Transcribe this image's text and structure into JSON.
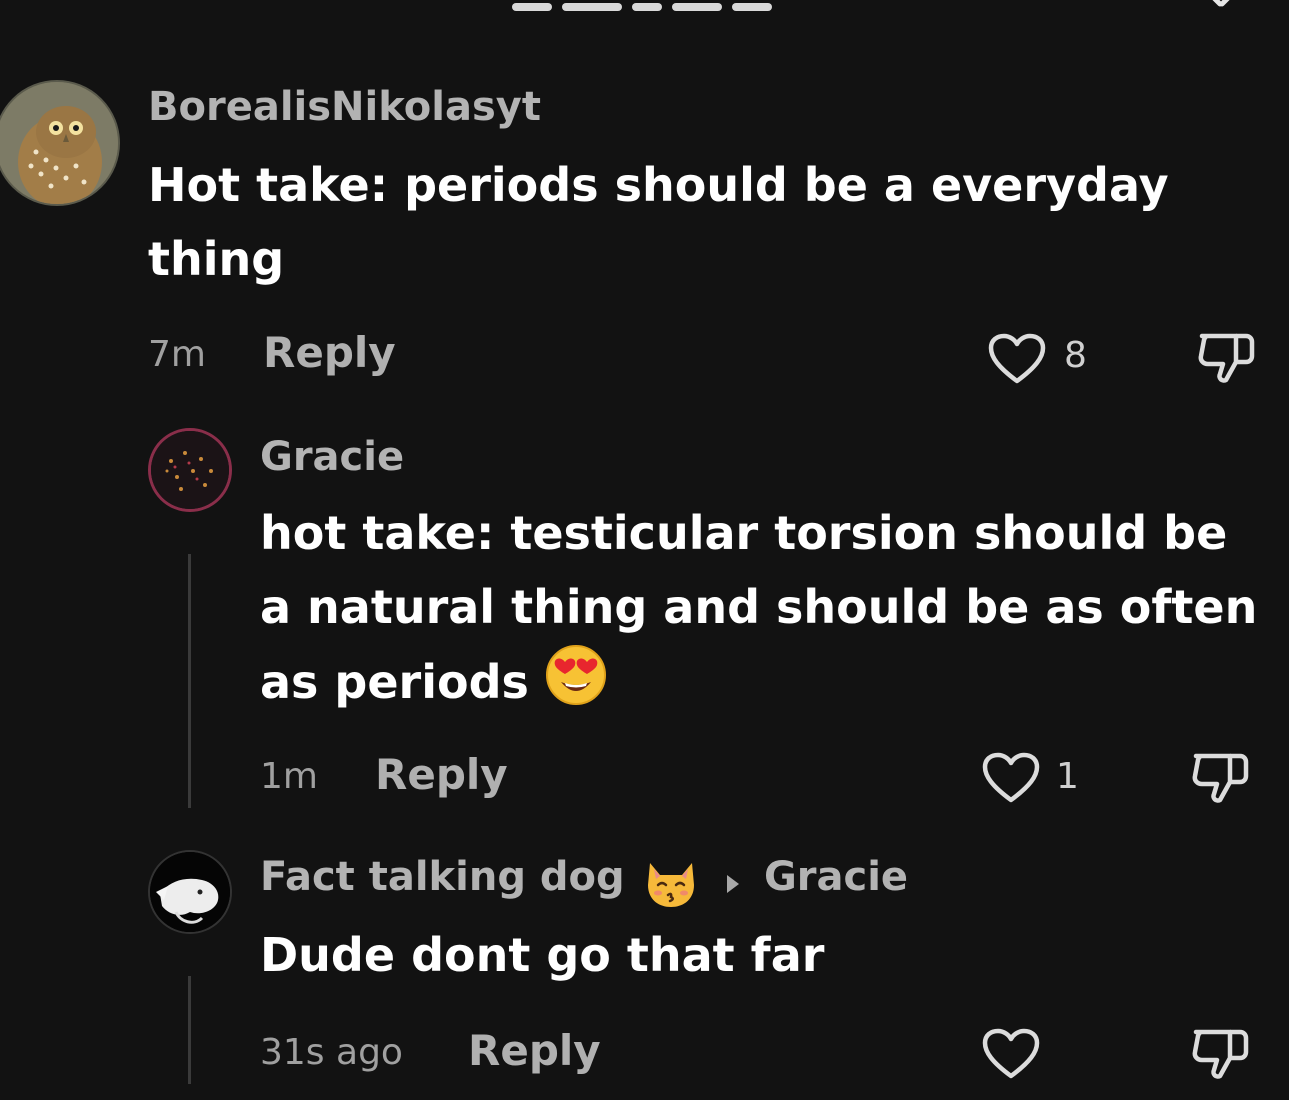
{
  "comments": [
    {
      "username": "BorealisNikolasyt",
      "text": "Hot take: periods should be a everyday thing",
      "time": "7m",
      "reply_label": "Reply",
      "likes": "8"
    },
    {
      "username": "Gracie",
      "text": "hot take: testicular torsion should be a natural thing and should be as often as periods",
      "time": "1m",
      "reply_label": "Reply",
      "likes": "1"
    },
    {
      "username": "Fact talking dog",
      "reply_to": "Gracie",
      "text": "Dude dont go that far",
      "time": "31s ago",
      "reply_label": "Reply",
      "likes": ""
    }
  ],
  "icons": {
    "like": "heart-outline-icon",
    "dislike": "thumbs-down-outline-icon",
    "close": "close-icon",
    "reply_arrow": "triangle-right-icon"
  },
  "colors": {
    "background": "#121212",
    "username": "#b3b3b3",
    "text": "#ffffff",
    "meta": "#a0a0a0"
  }
}
